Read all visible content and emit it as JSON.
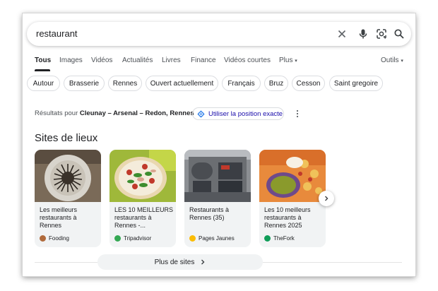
{
  "search": {
    "query": "restaurant"
  },
  "tabs": {
    "items": [
      "Tous",
      "Images",
      "Vidéos",
      "Actualités",
      "Livres",
      "Finance",
      "Vidéos courtes",
      "Plus"
    ],
    "active": "Tous",
    "tools": "Outils"
  },
  "chips": [
    "Autour",
    "Brasserie",
    "Rennes",
    "Ouvert actuellement",
    "Français",
    "Bruz",
    "Cesson",
    "Saint gregoire"
  ],
  "location": {
    "prefix": "Résultats pour",
    "place": "Cleunay – Arsenal – Redon, Rennes",
    "use_exact": "Utiliser la position exacte"
  },
  "section": {
    "title": "Sites de lieux"
  },
  "cards": [
    {
      "title": "Les meilleurs restaurants à Rennes",
      "source": "Fooding",
      "logo_color": "#b06a3b"
    },
    {
      "title": "LES 10 MEILLEURS restaurants à Rennes -...",
      "source": "Tripadvisor",
      "logo_color": "#34a853"
    },
    {
      "title": "Restaurants à Rennes (35)",
      "source": "Pages Jaunes",
      "logo_color": "#fbbc04"
    },
    {
      "title": "Les 10 meilleurs restaurants à Rennes 2025",
      "source": "TheFork",
      "logo_color": "#0f9d58"
    }
  ],
  "more": {
    "label": "Plus de sites"
  },
  "icons": {
    "clear": "close-icon",
    "voice": "microphone-icon",
    "lens": "lens-icon",
    "search": "search-icon",
    "next": "chevron-right-icon"
  },
  "colors": {
    "link": "#1a0dab",
    "accent": "#1a73e8",
    "text": "#202124",
    "muted": "#4d5156"
  }
}
